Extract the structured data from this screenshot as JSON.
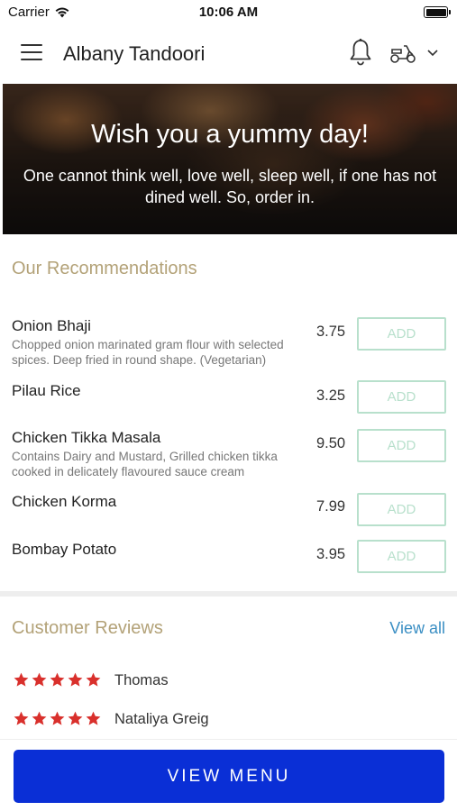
{
  "status_bar": {
    "carrier": "Carrier",
    "time": "10:06 AM"
  },
  "header": {
    "title": "Albany Tandoori"
  },
  "banner": {
    "title": "Wish you a yummy day!",
    "subtitle": "One cannot think well, love well, sleep well, if one has not dined well. So, order in."
  },
  "recommendations": {
    "title": "Our Recommendations",
    "items": [
      {
        "name": "Onion Bhaji",
        "description": "Chopped onion marinated gram flour with selected spices. Deep fried in round shape. (Vegetarian)",
        "price": "3.75",
        "add_label": "ADD"
      },
      {
        "name": "Pilau Rice",
        "description": "",
        "price": "3.25",
        "add_label": "ADD"
      },
      {
        "name": "Chicken Tikka Masala",
        "description": "Contains Dairy and Mustard, Grilled chicken tikka cooked in delicately flavoured sauce cream",
        "price": "9.50",
        "add_label": "ADD"
      },
      {
        "name": "Chicken Korma",
        "description": "",
        "price": "7.99",
        "add_label": "ADD"
      },
      {
        "name": "Bombay Potato",
        "description": "",
        "price": "3.95",
        "add_label": "ADD"
      }
    ]
  },
  "reviews": {
    "title": "Customer Reviews",
    "view_all_label": "View all",
    "items": [
      {
        "name": "Thomas",
        "rating": 5
      },
      {
        "name": "Nataliya Greig",
        "rating": 5
      }
    ]
  },
  "bottom": {
    "view_menu_label": "VIEW MENU"
  },
  "colors": {
    "accent": "#0a2fd6",
    "section_title": "#b3a278",
    "add_button": "#b8e0cc",
    "link": "#3b8fc4",
    "star": "#d9302c"
  }
}
